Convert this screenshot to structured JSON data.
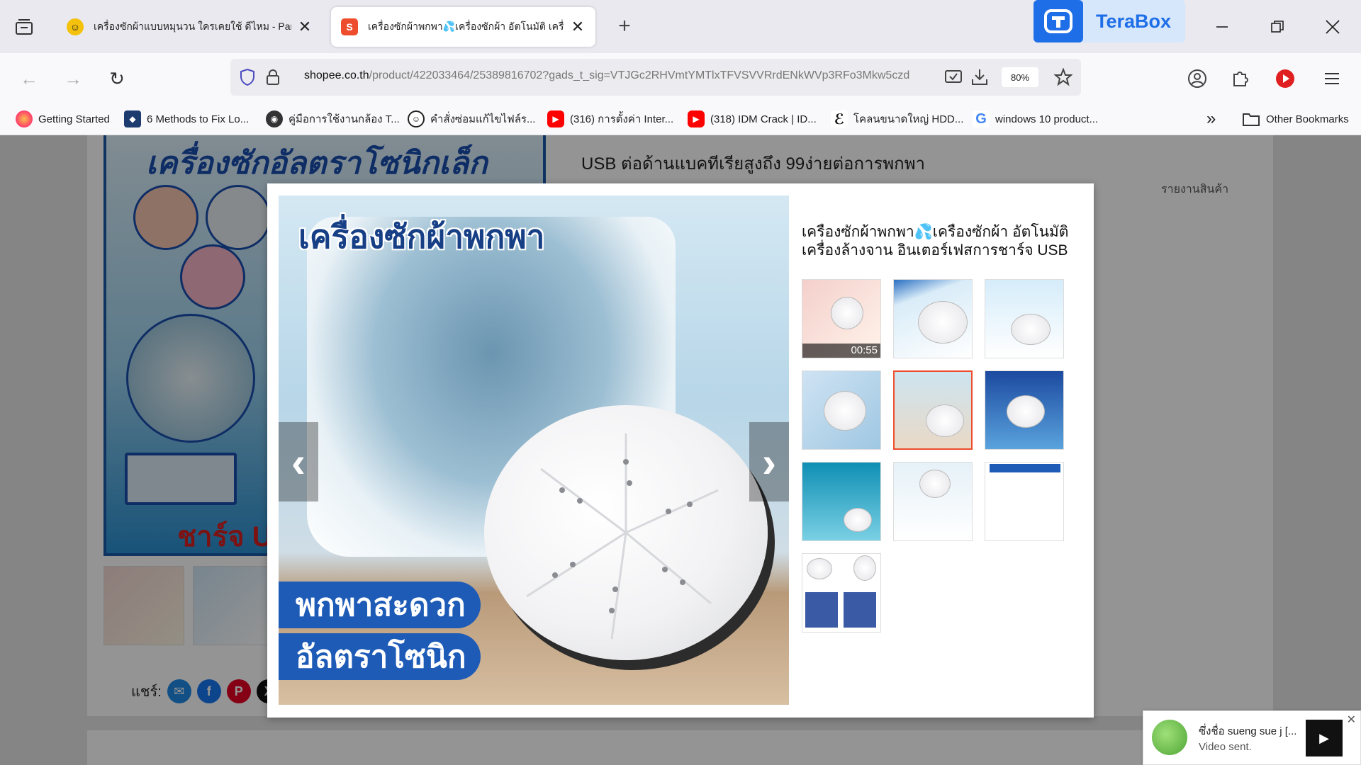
{
  "browser": {
    "tabs": [
      {
        "title": "เครื่องซักผ้าแบบหมุนวน ใครเคยใช้ ดีไหม - Pantip",
        "active": false,
        "icon": "pantip-icon"
      },
      {
        "title": "เครื่องซักผ้าพกพา💦เครื่องซักผ้า อัตโนมัติ เครื่องล้างจาน",
        "active": true,
        "icon": "shopee-icon"
      }
    ],
    "terabox_label": "TeraBox",
    "url_host": "shopee.co.th",
    "url_path": "/product/422033464/25389816702?gads_t_sig=VTJGc2RHVmtYMTlxTFVSVVRrdENkWVp3RFo3Mkw5czd",
    "zoom": "80%",
    "bookmarks": [
      {
        "label": "Getting Started",
        "icon": "firefox-icon",
        "color": "#ff7139"
      },
      {
        "label": "6 Methods to Fix Lo...",
        "icon": "app-icon",
        "color": "#1c3b6e"
      },
      {
        "label": "คู่มือการใช้งานกล้อง T...",
        "icon": "ninja-icon",
        "color": "#333333"
      },
      {
        "label": "คำสั่งซ่อมแก้ไขไฟล์ร...",
        "icon": "head-icon",
        "color": "#222222"
      },
      {
        "label": "(316) การตั้งค่า Inter...",
        "icon": "youtube-icon",
        "color": "#ff0000"
      },
      {
        "label": "(318) IDM Crack | ID...",
        "icon": "youtube-icon",
        "color": "#ff0000"
      },
      {
        "label": "โคลนขนาดใหญ่ HDD...",
        "icon": "e-icon",
        "color": "#111111"
      },
      {
        "label": "windows 10 product...",
        "icon": "google-icon",
        "color": "#4285f4"
      }
    ],
    "other_bookmarks": "Other Bookmarks"
  },
  "page": {
    "product_title_line2": "USB ต่อด้านแบคทีเรียสูงถึง 99ง่ายต่อการพกพา",
    "report": "รายงานสินค้า",
    "share_label": "แชร์:",
    "main_headline": "เครื่องซักอัลตราโซนิกเล็ก",
    "main_charge": "ชาร์จ US"
  },
  "modal": {
    "title": "เครื่องซักผ้าพกพา💦เครื่องซักผ้า อัตโนมัติ เครื่องล้างจาน อินเตอร์เฟสการชาร์จ USB",
    "image_headline": "เครื่องซักผ้าพกพา",
    "ribbon1": "พกพาสะดวก",
    "ribbon2": "อัลตราโซนิก",
    "video_duration": "00:55",
    "thumbnails_count": 10,
    "active_thumbnail": 5
  },
  "toast": {
    "name": "ซึ่งชื่อ sueng sue j [...",
    "message": "Video sent."
  },
  "colors": {
    "shopee": "#ee4d2d",
    "terabox": "#1e6ee8",
    "ribbon": "#1d5bb7"
  }
}
